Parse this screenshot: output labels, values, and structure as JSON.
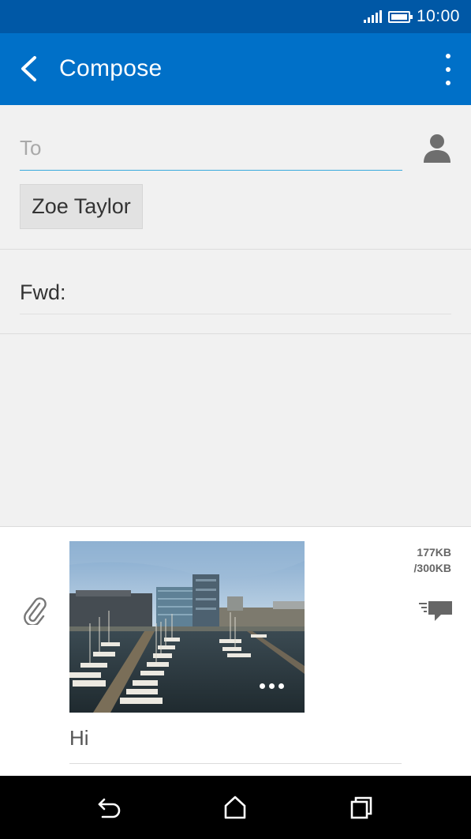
{
  "status_bar": {
    "time": "10:00",
    "signal_icon": "signal-icon",
    "battery_icon": "battery-icon",
    "battery_level": 1.0
  },
  "app_bar": {
    "title": "Compose",
    "back_icon": "chevron-left-icon",
    "menu_icon": "overflow-menu-icon"
  },
  "recipients": {
    "to_placeholder": "To",
    "contact_icon": "person-icon",
    "chips": [
      "Zoe Taylor"
    ]
  },
  "subject": {
    "value": "Fwd:"
  },
  "attachment": {
    "size_used": "177KB",
    "size_limit": "/300KB",
    "attach_icon": "paperclip-icon",
    "quick_text_icon": "quick-text-icon",
    "more_icon": "more-horizontal-icon"
  },
  "body": {
    "value": "Hi"
  },
  "nav": {
    "back_icon": "back-icon",
    "home_icon": "home-icon",
    "recents_icon": "recents-icon"
  },
  "colors": {
    "status_bar": "#0058a6",
    "app_bar": "#0070c8",
    "accent_underline": "#39a9dd"
  }
}
